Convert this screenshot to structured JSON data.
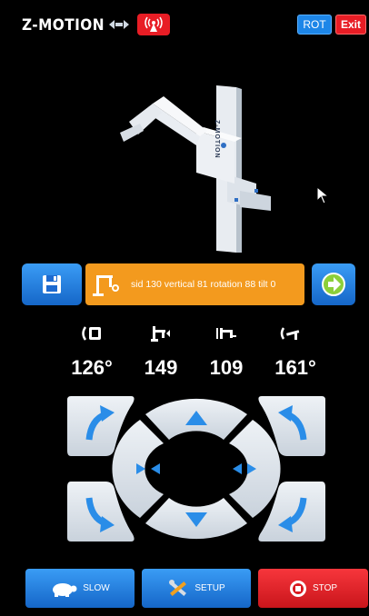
{
  "header": {
    "title": "Z-MOTION",
    "rot_label": "ROT",
    "exit_label": "Exit"
  },
  "viewport": {
    "model_label": "Z-MOTION"
  },
  "status": {
    "text": "sid 130 vertical 81 rotation 88 tilt  0"
  },
  "readouts": [
    {
      "icon": "rotation-icon",
      "value": "126°"
    },
    {
      "icon": "vertical-icon",
      "value": "149"
    },
    {
      "icon": "sid-icon",
      "value": "109"
    },
    {
      "icon": "tilt-icon",
      "value": "161°"
    }
  ],
  "footer": {
    "slow_label": "SLOW",
    "setup_label": "SETUP",
    "stop_label": "STOP"
  },
  "colors": {
    "accent_blue": "#1d86e8",
    "danger_red": "#e81d25",
    "status_orange": "#f39a1e",
    "pad_gray": "#dfe5ec"
  }
}
